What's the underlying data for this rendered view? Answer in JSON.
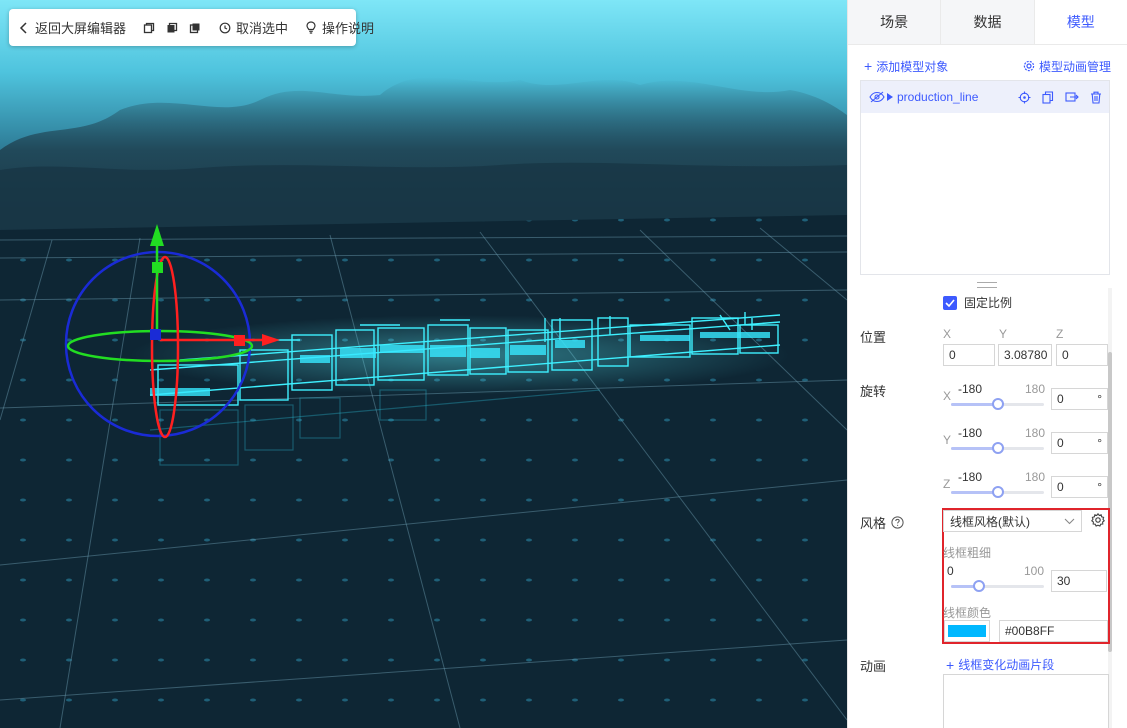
{
  "toolbar": {
    "back_label": "返回大屏编辑器",
    "deselect_label": "取消选中",
    "help_label": "操作说明"
  },
  "panel": {
    "tabs": [
      {
        "label": "场景",
        "active": false
      },
      {
        "label": "数据",
        "active": false
      },
      {
        "label": "模型",
        "active": true
      }
    ],
    "add_model_label": "添加模型对象",
    "anim_manage_label": "模型动画管理",
    "tree": {
      "items": [
        {
          "name": "production_line",
          "visible": false
        }
      ]
    },
    "fixed_ratio_label": "固定比例",
    "fixed_ratio_checked": true,
    "position": {
      "label": "位置",
      "x_label": "X",
      "y_label": "Y",
      "z_label": "Z",
      "x": "0",
      "y": "3.08780",
      "z": "0"
    },
    "rotation": {
      "label": "旋转",
      "axes": [
        {
          "axis": "X",
          "min": "-180",
          "max": "180",
          "value": "0",
          "unit": "°",
          "fraction": 0.5
        },
        {
          "axis": "Y",
          "min": "-180",
          "max": "180",
          "value": "0",
          "unit": "°",
          "fraction": 0.5
        },
        {
          "axis": "Z",
          "min": "-180",
          "max": "180",
          "value": "0",
          "unit": "°",
          "fraction": 0.5
        }
      ]
    },
    "style": {
      "label": "风格",
      "selected": "线框风格(默认)",
      "thickness_label": "线框粗细",
      "thickness_min": "0",
      "thickness_max": "100",
      "thickness_value": "30",
      "thickness_fraction": 0.3,
      "color_label": "线框颜色",
      "color_value": "#00B8FF"
    },
    "animation": {
      "label": "动画",
      "add_label": "线框变化动画片段"
    }
  },
  "colors": {
    "accent": "#3d5afe",
    "wireframe": "#00B8FF",
    "highlight_border": "#e0242b",
    "gizmo_x": "#ff2020",
    "gizmo_y": "#22dd22",
    "gizmo_z": "#1a2bd6"
  },
  "icons": {
    "back": "chevron-left-icon",
    "view1": "copy-icon",
    "view2": "stack-icon",
    "view3": "duplicate-icon",
    "deselect": "target-clock-icon",
    "help": "lightbulb-icon",
    "add": "plus-icon",
    "anim_manage": "gear-icon",
    "visibility": "eye-off-icon",
    "expand": "caret-right-icon",
    "locate": "crosshair-icon",
    "clone": "copy-icon",
    "export": "export-icon",
    "delete": "trash-icon",
    "help_circle": "question-circle-icon",
    "settings": "gear-icon",
    "select": "chevron-down-icon"
  }
}
